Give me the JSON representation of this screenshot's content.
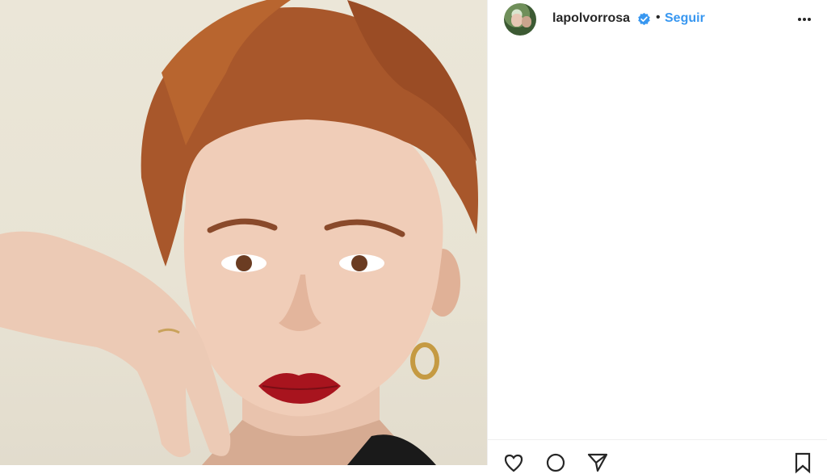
{
  "post": {
    "image_alt": "Portrait photo",
    "header": {
      "username": "lapolvorrosa",
      "separator": "•",
      "follow_label": "Seguir"
    },
    "icons": [
      "more-options-icon",
      "verified-badge-icon",
      "heart-icon",
      "comment-icon",
      "share-icon",
      "bookmark-icon"
    ],
    "colors": {
      "accent": "#3897f0",
      "text": "#262626",
      "border": "#efefef"
    }
  }
}
